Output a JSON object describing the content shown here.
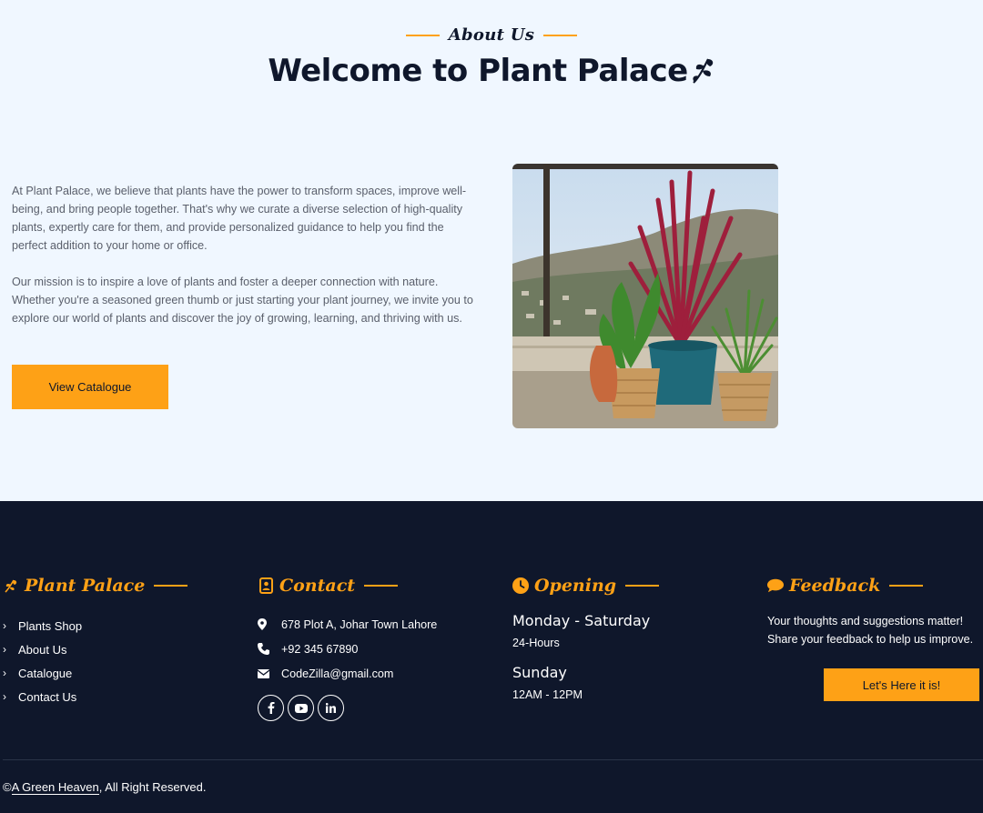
{
  "about": {
    "subtitle": "About Us",
    "title": "Welcome to Plant Palace",
    "paragraph1": "At Plant Palace, we believe that plants have the power to transform spaces, improve well-being, and bring people together. That's why we curate a diverse selection of high-quality plants, expertly care for them, and provide personalized guidance to help you find the perfect addition to your home or office.",
    "paragraph2": "Our mission is to inspire a love of plants and foster a deeper connection with nature. Whether you're a seasoned green thumb or just starting your plant journey, we invite you to explore our world of plants and discover the joy of growing, learning, and thriving with us.",
    "button": "View Catalogue"
  },
  "footer": {
    "brand": {
      "heading": "Plant Palace",
      "links": [
        "Plants Shop",
        "About Us",
        "Catalogue",
        "Contact Us"
      ]
    },
    "contact": {
      "heading": "Contact",
      "address": "678 Plot A, Johar Town Lahore",
      "phone": "+92 345 67890",
      "email": "CodeZilla@gmail.com",
      "socials": [
        "facebook-icon",
        "youtube-icon",
        "linkedin-icon"
      ]
    },
    "opening": {
      "heading": "Opening",
      "day1": "Monday - Saturday",
      "hours1": "24-Hours",
      "day2": "Sunday",
      "hours2": "12AM - 12PM"
    },
    "feedback": {
      "heading": "Feedback",
      "text": "Your thoughts and suggestions matter! Share your feedback to help us improve.",
      "button": "Let's Here it is!"
    },
    "copyright": {
      "symbol": "©",
      "link": "A Green Heaven",
      "suffix": ", All Right Reserved."
    }
  },
  "colors": {
    "accent": "#fea116",
    "dark": "#0f172b",
    "light_bg": "#f0f7ff"
  }
}
